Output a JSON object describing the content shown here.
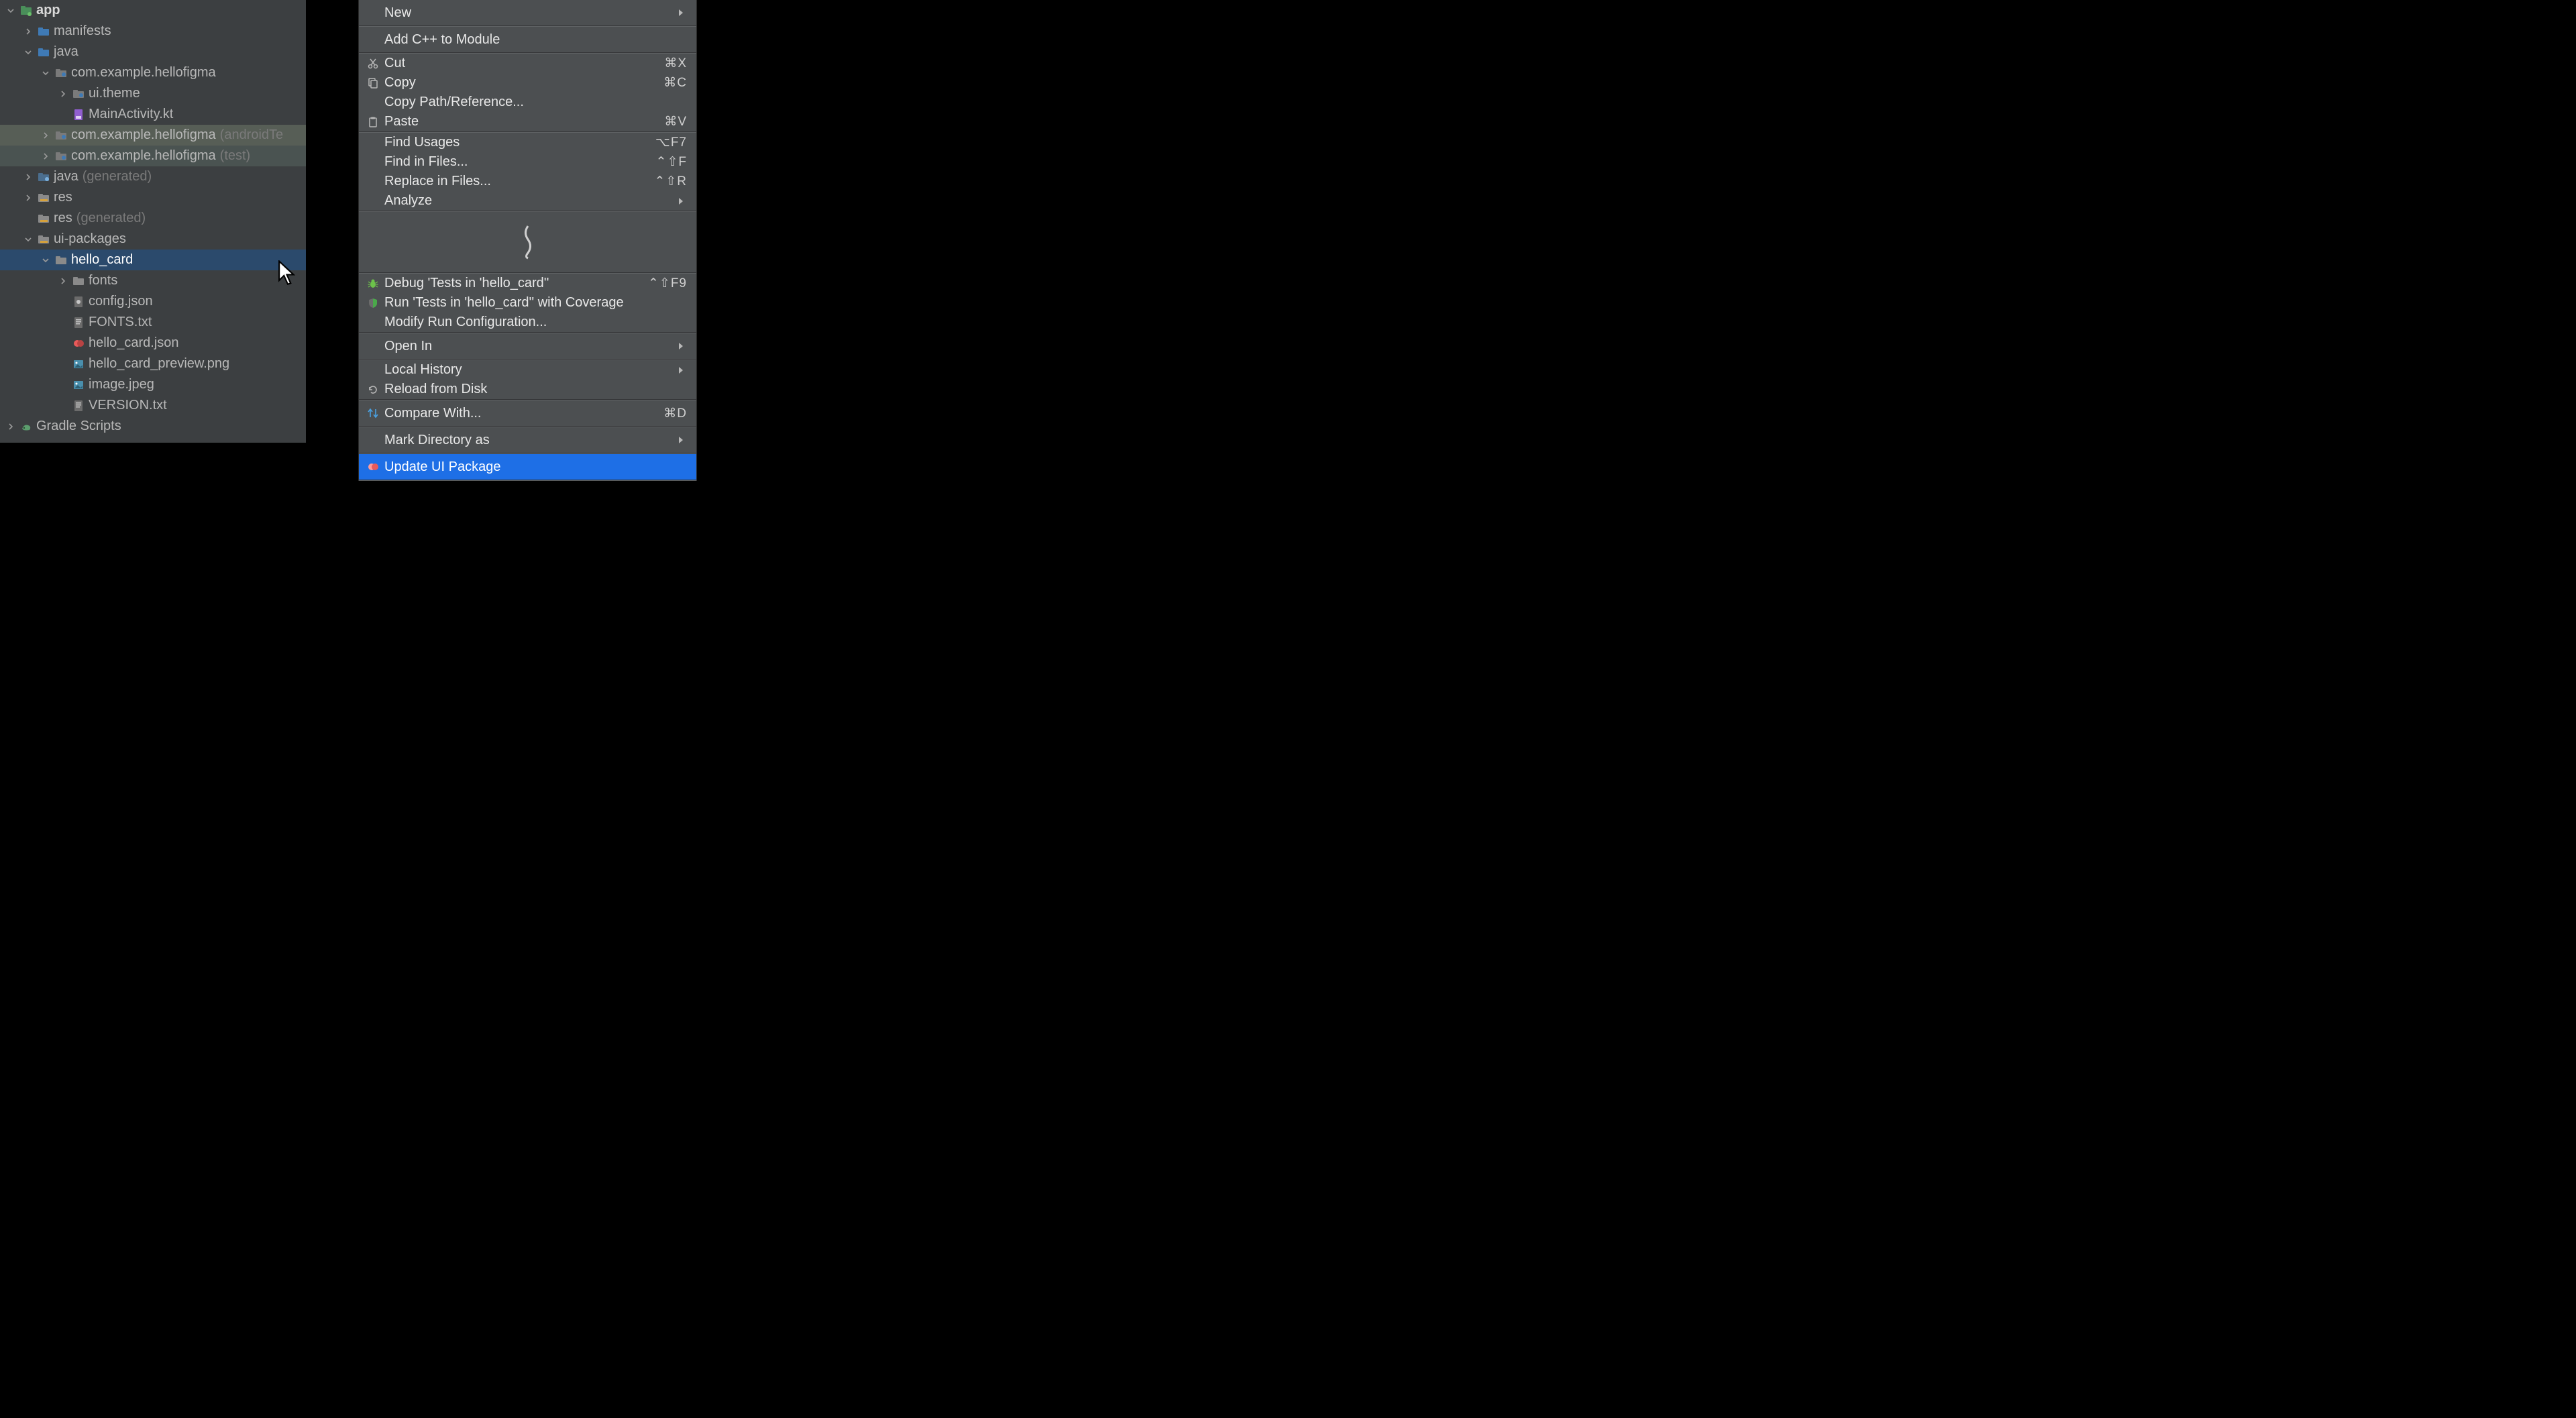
{
  "tree": [
    {
      "depth": 0,
      "chev": "down",
      "icon": "module",
      "label": "app",
      "bold": true
    },
    {
      "depth": 1,
      "chev": "right",
      "icon": "folder",
      "label": "manifests"
    },
    {
      "depth": 1,
      "chev": "down",
      "icon": "folder",
      "label": "java"
    },
    {
      "depth": 2,
      "chev": "down",
      "icon": "package",
      "label": "com.example.hellofigma"
    },
    {
      "depth": 3,
      "chev": "right",
      "icon": "package",
      "label": "ui.theme"
    },
    {
      "depth": 3,
      "chev": "none",
      "icon": "ktfile",
      "label": "MainActivity.kt"
    },
    {
      "depth": 2,
      "chev": "right",
      "icon": "package",
      "label": "com.example.hellofigma",
      "suffix": "(androidTe",
      "style": "shade2"
    },
    {
      "depth": 2,
      "chev": "right",
      "icon": "package",
      "label": "com.example.hellofigma",
      "suffix": "(test)",
      "style": "shade1"
    },
    {
      "depth": 1,
      "chev": "right",
      "icon": "genfolder",
      "label": "java",
      "suffix": "(generated)"
    },
    {
      "depth": 1,
      "chev": "right",
      "icon": "resfolder",
      "label": "res"
    },
    {
      "depth": 1,
      "chev": "none",
      "icon": "resfolder",
      "label": "res",
      "suffix": "(generated)"
    },
    {
      "depth": 1,
      "chev": "down",
      "icon": "resfolder",
      "label": "ui-packages"
    },
    {
      "depth": 2,
      "chev": "down",
      "icon": "dir",
      "label": "hello_card",
      "style": "selected"
    },
    {
      "depth": 3,
      "chev": "right",
      "icon": "dir",
      "label": "fonts"
    },
    {
      "depth": 3,
      "chev": "none",
      "icon": "json",
      "label": "config.json"
    },
    {
      "depth": 3,
      "chev": "none",
      "icon": "txt",
      "label": "FONTS.txt"
    },
    {
      "depth": 3,
      "chev": "none",
      "icon": "figma",
      "label": "hello_card.json"
    },
    {
      "depth": 3,
      "chev": "none",
      "icon": "img",
      "label": "hello_card_preview.png"
    },
    {
      "depth": 3,
      "chev": "none",
      "icon": "img",
      "label": "image.jpeg"
    },
    {
      "depth": 3,
      "chev": "none",
      "icon": "txt",
      "label": "VERSION.txt"
    },
    {
      "depth": 0,
      "chev": "right",
      "icon": "gradle",
      "label": "Gradle Scripts"
    }
  ],
  "menu_groups": [
    [
      {
        "icon": "",
        "label": "New",
        "sub": true,
        "tall": true
      }
    ],
    [
      {
        "icon": "",
        "label": "Add C++ to Module",
        "tall": true
      }
    ],
    [
      {
        "icon": "cut",
        "label": "Cut",
        "shortcut": "⌘X"
      },
      {
        "icon": "copy",
        "label": "Copy",
        "shortcut": "⌘C"
      },
      {
        "icon": "",
        "label": "Copy Path/Reference..."
      },
      {
        "icon": "paste",
        "label": "Paste",
        "shortcut": "⌘V"
      }
    ],
    [
      {
        "icon": "",
        "label": "Find Usages",
        "shortcut": "⌥F7"
      },
      {
        "icon": "",
        "label": "Find in Files...",
        "shortcut": "⌃⇧F"
      },
      {
        "icon": "",
        "label": "Replace in Files...",
        "shortcut": "⌃⇧R"
      },
      {
        "icon": "",
        "label": "Analyze",
        "sub": true
      }
    ],
    "snip",
    [
      {
        "icon": "bug",
        "label": "Debug 'Tests in 'hello_card''",
        "shortcut": "⌃⇧F9"
      },
      {
        "icon": "coverage",
        "label": "Run 'Tests in 'hello_card'' with Coverage"
      },
      {
        "icon": "",
        "label": "Modify Run Configuration..."
      }
    ],
    [
      {
        "icon": "",
        "label": "Open In",
        "sub": true,
        "tall": true
      }
    ],
    [
      {
        "icon": "",
        "label": "Local History",
        "sub": true
      },
      {
        "icon": "reload",
        "label": "Reload from Disk"
      }
    ],
    [
      {
        "icon": "compare",
        "label": "Compare With...",
        "shortcut": "⌘D",
        "tall": true
      }
    ],
    [
      {
        "icon": "",
        "label": "Mark Directory as",
        "sub": true,
        "tall": true
      }
    ],
    [
      {
        "icon": "figma",
        "label": "Update UI Package",
        "highlight": true,
        "tall": true
      }
    ]
  ]
}
